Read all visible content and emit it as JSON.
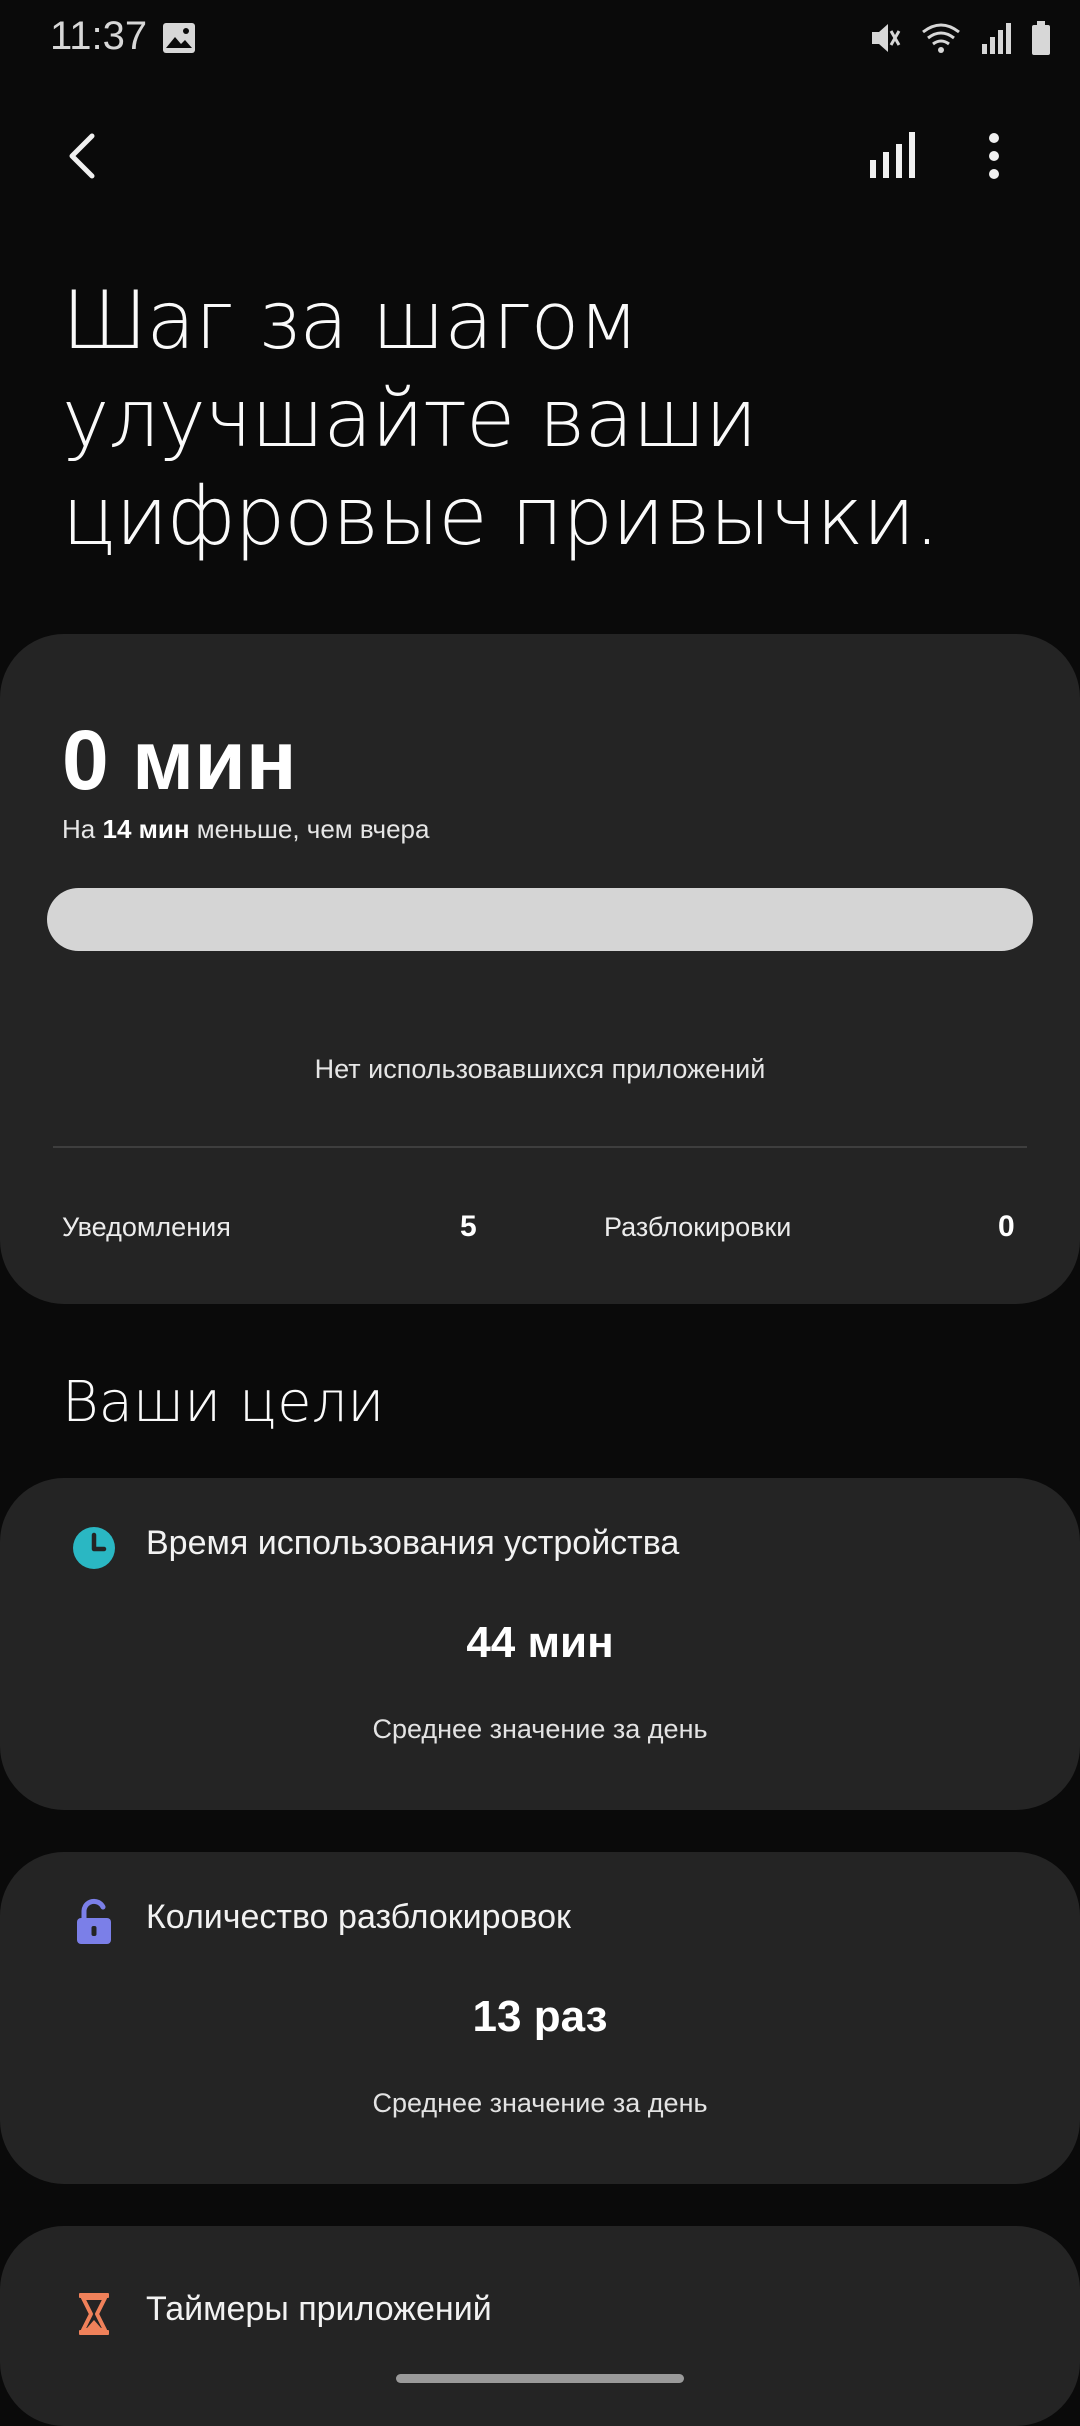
{
  "status_bar": {
    "time": "11:37",
    "icons": [
      "gallery-icon",
      "mute-icon",
      "wifi-icon",
      "signal-icon",
      "battery-icon"
    ]
  },
  "app_bar": {
    "icons": [
      "back-arrow-icon",
      "bar-chart-icon",
      "more-vert-icon"
    ]
  },
  "hero": {
    "line1": "Шаг за шагом",
    "line2": "улучшайте ваши",
    "line3": "цифровые привычки."
  },
  "usage": {
    "value": "0 мин",
    "compare_prefix": "На",
    "compare_amount": "14 мин",
    "compare_suffix": "меньше, чем вчера",
    "empty_text": "Нет использовавшихся приложений",
    "notifications_label": "Уведомления",
    "notifications_value": "5",
    "unlocks_label": "Разблокировки",
    "unlocks_value": "0"
  },
  "goals": {
    "heading": "Ваши цели",
    "items": [
      {
        "title": "Время использования устройства",
        "value": "44 мин",
        "sub": "Среднее значение за день",
        "icon": "clock-icon",
        "color": "#2ab7c3"
      },
      {
        "title": "Количество разблокировок",
        "value": "13 раз",
        "sub": "Среднее значение за день",
        "icon": "unlock-icon",
        "color": "#7b7fe8"
      },
      {
        "title": "Таймеры приложений",
        "icon": "hourglass-icon",
        "color": "#f0815a"
      }
    ]
  },
  "colors": {
    "background": "#0a0a0a",
    "card": "#242424",
    "usage_bar": "#d5d5d5"
  }
}
